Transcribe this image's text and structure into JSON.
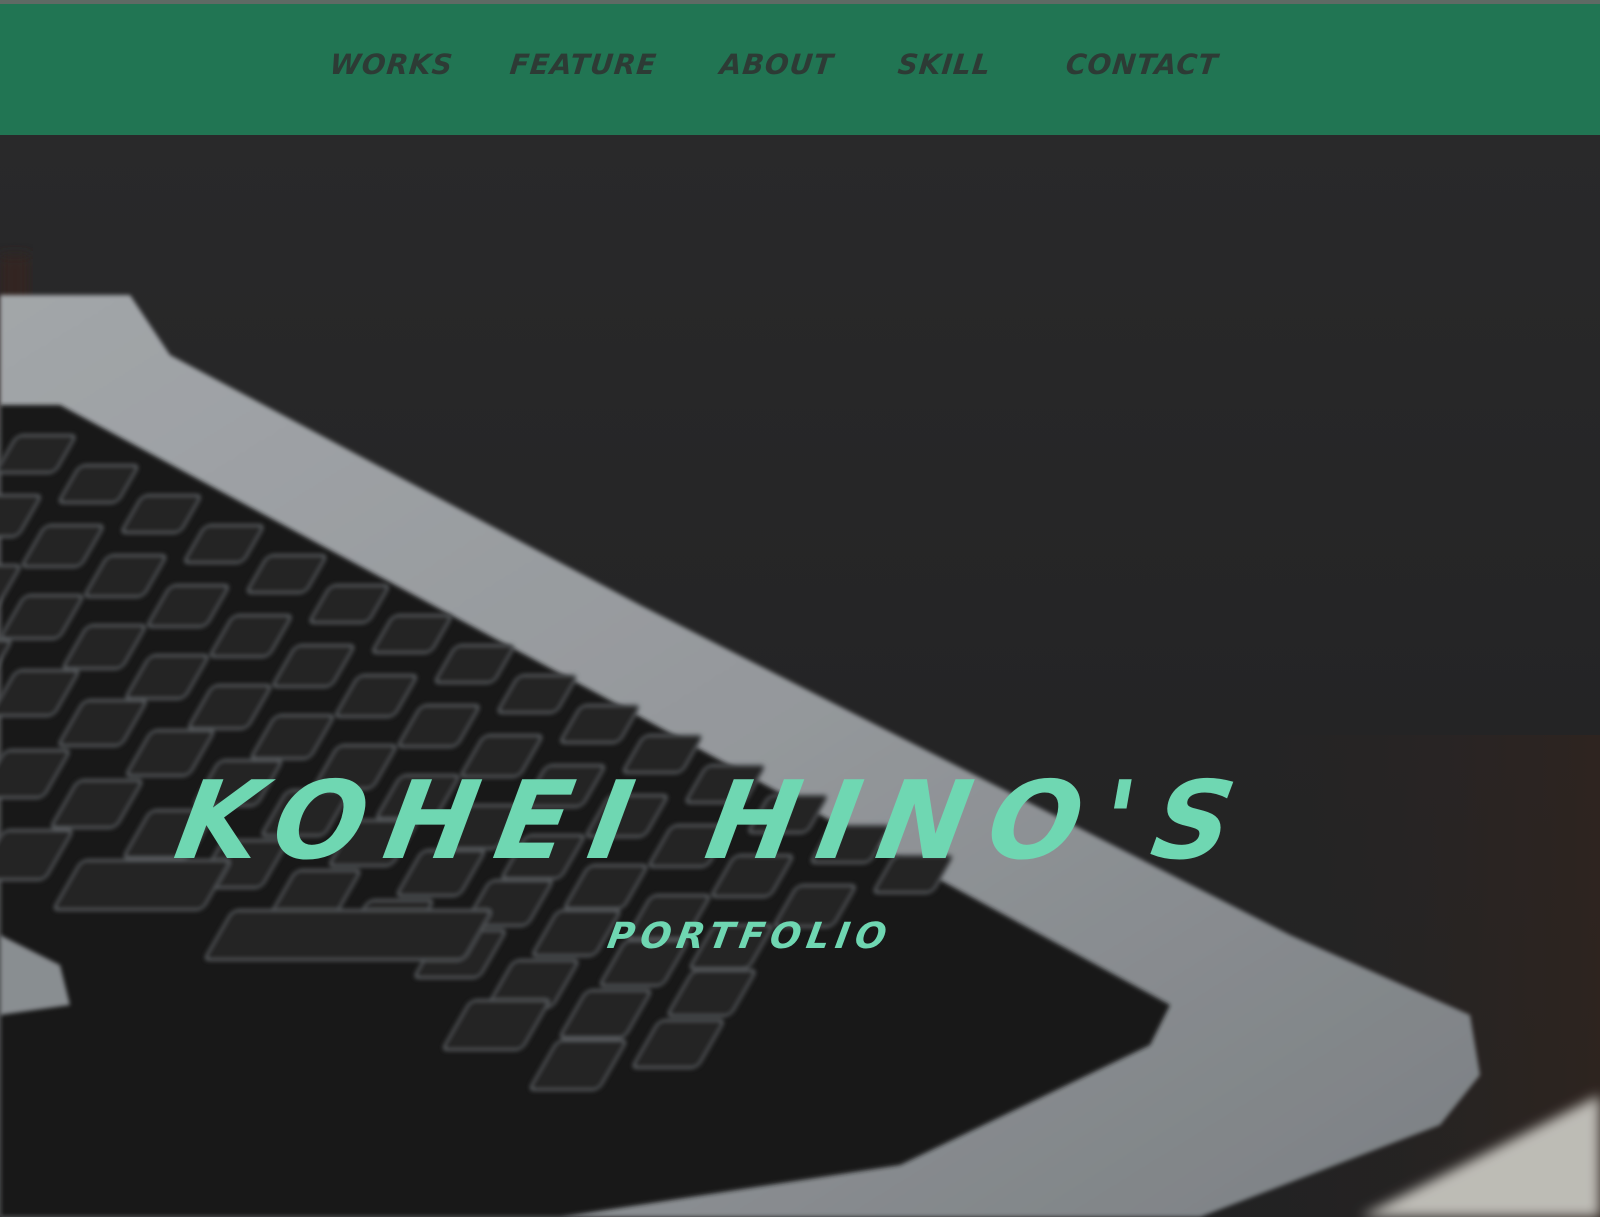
{
  "nav": {
    "items": [
      {
        "label": "WORKS"
      },
      {
        "label": "FEATURE"
      },
      {
        "label": "ABOUT"
      },
      {
        "label": "SKILL"
      },
      {
        "label": "CONTACT"
      }
    ]
  },
  "hero": {
    "title": "KOHEI HINO'S",
    "subtitle": "PORTFOLIO",
    "background_image": "laptop-keyboard-photo"
  },
  "colors": {
    "nav_background": "#217553",
    "nav_text": "#2d3b35",
    "hero_text": "#6fd7b2",
    "hero_background": "#2f2f30"
  }
}
